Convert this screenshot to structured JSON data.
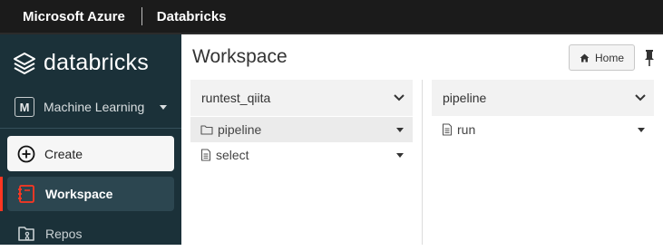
{
  "topbar": {
    "brand": "Microsoft Azure",
    "product": "Databricks"
  },
  "sidebar": {
    "logo_text": "databricks",
    "persona": {
      "badge": "M",
      "label": "Machine Learning"
    },
    "create_label": "Create",
    "items": [
      {
        "label": "Workspace",
        "icon": "workspace-icon",
        "active": true
      },
      {
        "label": "Repos",
        "icon": "repos-icon",
        "active": false
      }
    ]
  },
  "main": {
    "title": "Workspace",
    "home_label": "Home",
    "columns": [
      {
        "header": "runtest_qiita",
        "rows": [
          {
            "label": "pipeline",
            "type": "folder",
            "selected": true
          },
          {
            "label": "select",
            "type": "notebook",
            "selected": false
          }
        ]
      },
      {
        "header": "pipeline",
        "rows": [
          {
            "label": "run",
            "type": "notebook",
            "selected": false
          }
        ]
      }
    ]
  },
  "colors": {
    "accent": "#ff3621",
    "sidebar_bg": "#1b3139",
    "topbar_bg": "#1b1b1b"
  }
}
